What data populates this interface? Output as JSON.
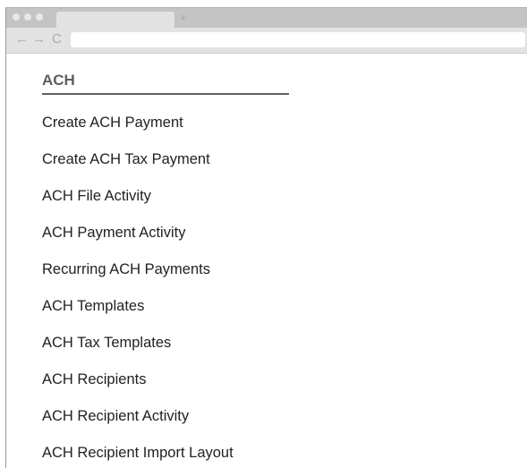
{
  "browser": {
    "new_tab_glyph": "+",
    "back_icon": "←",
    "forward_icon": "→",
    "reload_icon": "C"
  },
  "section": {
    "title": "ACH"
  },
  "menu": {
    "items": [
      {
        "label": "Create ACH Payment"
      },
      {
        "label": "Create ACH Tax Payment"
      },
      {
        "label": "ACH File Activity"
      },
      {
        "label": "ACH Payment Activity"
      },
      {
        "label": "Recurring ACH Payments"
      },
      {
        "label": "ACH Templates"
      },
      {
        "label": "ACH Tax Templates"
      },
      {
        "label": "ACH Recipients"
      },
      {
        "label": "ACH Recipient Activity"
      },
      {
        "label": "ACH Recipient Import Layout"
      }
    ]
  }
}
